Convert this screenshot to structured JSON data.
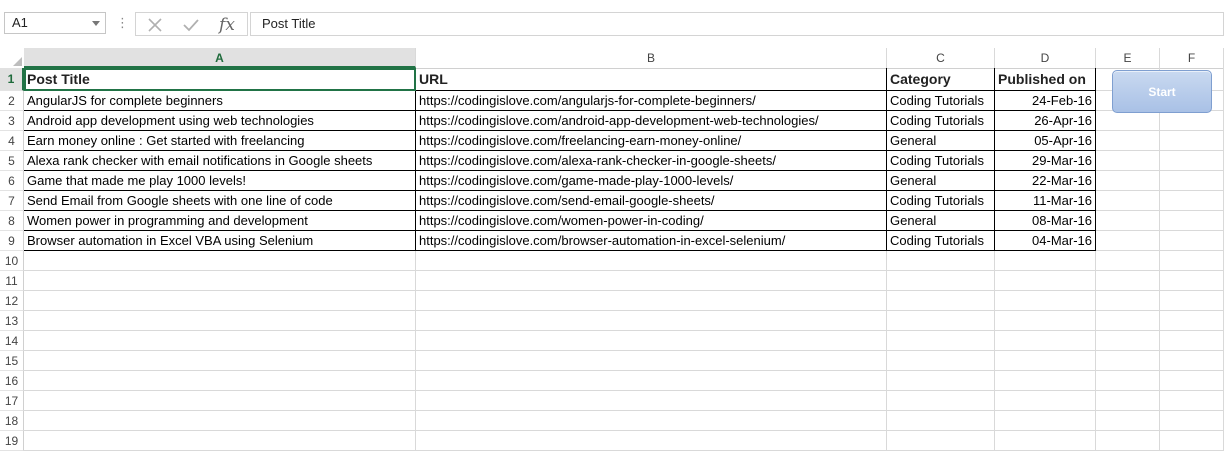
{
  "formula_bar": {
    "name_box": "A1",
    "formula": "Post Title",
    "fx_label": "fx",
    "icons": [
      "cancel-icon",
      "enter-icon",
      "insert-function-icon"
    ]
  },
  "columns": [
    "A",
    "B",
    "C",
    "D",
    "E",
    "F"
  ],
  "rows_numbers": [
    "1",
    "2",
    "3",
    "4",
    "5",
    "6",
    "7",
    "8",
    "9",
    "10",
    "11",
    "12",
    "13",
    "14",
    "15",
    "16",
    "17",
    "18",
    "19"
  ],
  "headers": {
    "A": "Post Title",
    "B": "URL",
    "C": "Category",
    "D": "Published on"
  },
  "rows": [
    [
      "AngularJS for complete beginners",
      "https://codingislove.com/angularjs-for-complete-beginners/",
      "Coding Tutorials",
      "24-Feb-16"
    ],
    [
      "Android app development using web technologies",
      "https://codingislove.com/android-app-development-web-technologies/",
      "Coding Tutorials",
      "26-Apr-16"
    ],
    [
      "Earn money online : Get started with freelancing",
      "https://codingislove.com/freelancing-earn-money-online/",
      "General",
      "05-Apr-16"
    ],
    [
      "Alexa rank checker with email notifications in Google sheets",
      "https://codingislove.com/alexa-rank-checker-in-google-sheets/",
      "Coding Tutorials",
      "29-Mar-16"
    ],
    [
      "Game that made me play 1000 levels!",
      "https://codingislove.com/game-made-play-1000-levels/",
      "General",
      "22-Mar-16"
    ],
    [
      "Send Email from Google sheets with one line of code",
      "https://codingislove.com/send-email-google-sheets/",
      "Coding Tutorials",
      "11-Mar-16"
    ],
    [
      "Women power in programming and development",
      "https://codingislove.com/women-power-in-coding/",
      "General",
      "08-Mar-16"
    ],
    [
      "Browser automation in Excel VBA using Selenium",
      "https://codingislove.com/browser-automation-in-excel-selenium/",
      "Coding Tutorials",
      "04-Mar-16"
    ]
  ],
  "start_button": {
    "label": "Start"
  },
  "colors": {
    "accent": "#217346",
    "button": "#b8cdeb"
  }
}
